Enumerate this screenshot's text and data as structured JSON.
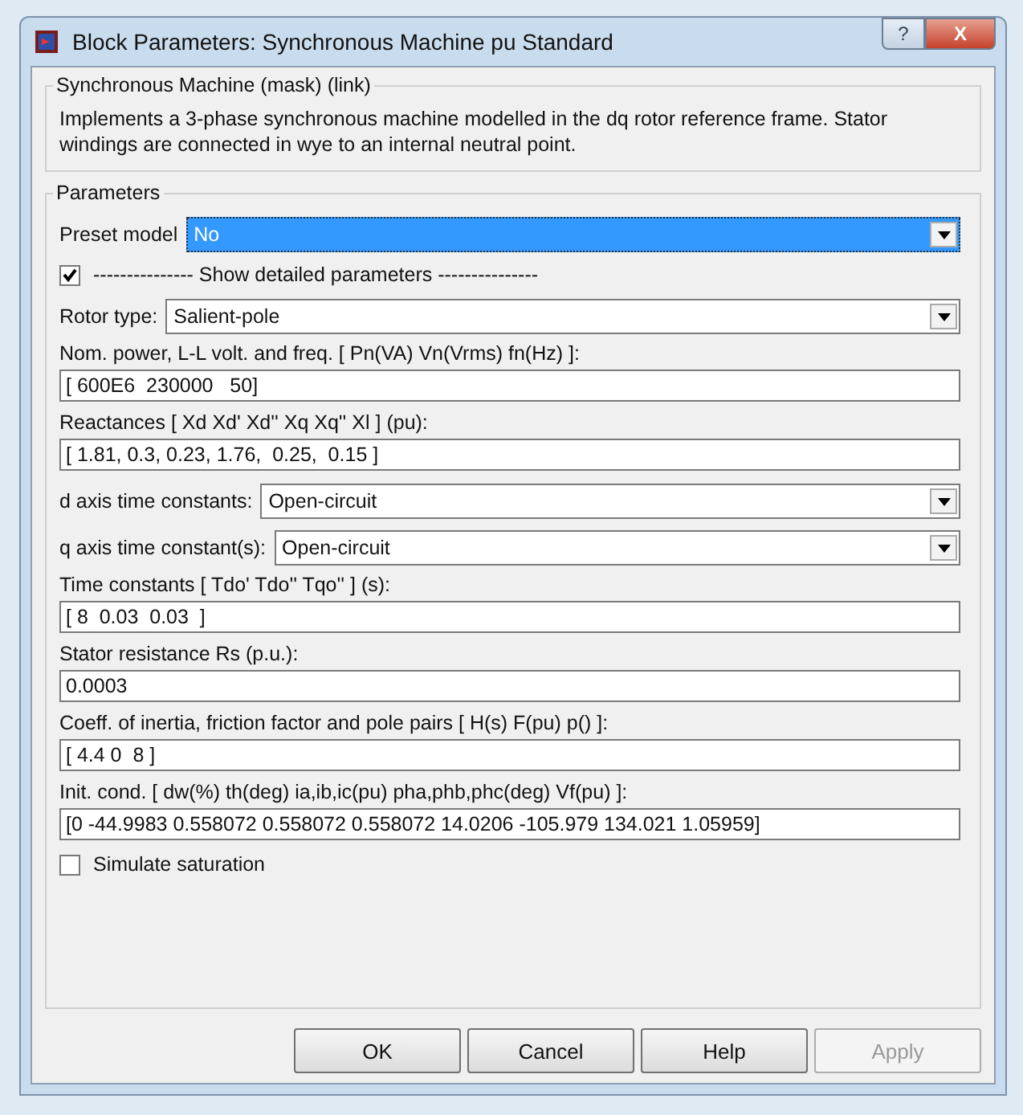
{
  "window": {
    "title": "Block Parameters: Synchronous Machine pu Standard",
    "help_button": "?",
    "close_button": "X"
  },
  "mask": {
    "title": "Synchronous Machine (mask) (link)",
    "description": "Implements a 3-phase synchronous machine modelled in the dq rotor reference frame. Stator windings are connected in wye to an internal neutral point."
  },
  "parameters": {
    "title": "Parameters",
    "items": [
      {
        "kind": "dropdown",
        "label": "Preset  model",
        "value": "No",
        "focused": true
      },
      {
        "kind": "checkbox",
        "label": "--------------- Show detailed parameters ---------------",
        "checked": true
      },
      {
        "kind": "dropdown",
        "label": "Rotor type:",
        "value": "Salient-pole",
        "focused": false
      },
      {
        "kind": "field",
        "label": "Nom. power, L-L volt. and freq. [ Pn(VA)  Vn(Vrms)  fn(Hz) ]:",
        "value": "[ 600E6  230000   50]"
      },
      {
        "kind": "field",
        "label": "Reactances [ Xd Xd' Xd'' Xq Xq'' Xl ] (pu):",
        "value": "[ 1.81, 0.3, 0.23, 1.76,  0.25,  0.15 ]"
      },
      {
        "kind": "dropdown",
        "label": "d axis time constants:",
        "value": "Open-circuit",
        "focused": false
      },
      {
        "kind": "dropdown",
        "label": "q axis time constant(s):",
        "value": "Open-circuit",
        "focused": false
      },
      {
        "kind": "field",
        "label": "Time constants [ Tdo'  Tdo''  Tqo'' ] (s):",
        "value": "[ 8  0.03  0.03  ]"
      },
      {
        "kind": "field",
        "label": "Stator resistance Rs (p.u.):",
        "value": "0.0003"
      },
      {
        "kind": "field",
        "label": "Coeff. of inertia, friction factor and pole pairs [ H(s)  F(pu)  p() ]:",
        "value": "[ 4.4 0  8 ]"
      },
      {
        "kind": "field",
        "label": "Init. cond. [ dw(%)  th(deg)  ia,ib,ic(pu)  pha,phb,phc(deg)  Vf(pu) ]:",
        "value": "[0 -44.9983 0.558072 0.558072 0.558072 14.0206 -105.979 134.021 1.05959]"
      },
      {
        "kind": "checkbox",
        "label": "Simulate saturation",
        "checked": false
      }
    ]
  },
  "buttons": [
    {
      "label": "OK",
      "disabled": false
    },
    {
      "label": "Cancel",
      "disabled": false
    },
    {
      "label": "Help",
      "disabled": false
    },
    {
      "label": "Apply",
      "disabled": true
    }
  ]
}
